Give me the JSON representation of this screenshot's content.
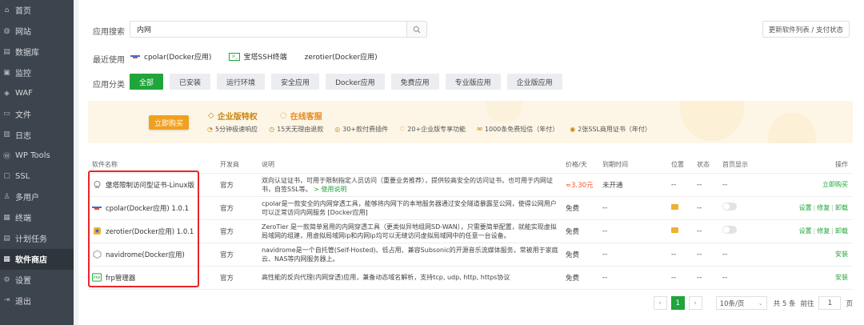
{
  "sidebar": {
    "items": [
      {
        "label": "首页",
        "icon": "home-icon",
        "glyph": "⌂"
      },
      {
        "label": "网站",
        "icon": "globe-icon",
        "glyph": "◍"
      },
      {
        "label": "数据库",
        "icon": "database-icon",
        "glyph": "▤"
      },
      {
        "label": "监控",
        "icon": "monitor-icon",
        "glyph": "▣"
      },
      {
        "label": "WAF",
        "icon": "shield-icon",
        "glyph": "◈"
      },
      {
        "label": "文件",
        "icon": "folder-icon",
        "glyph": "▭"
      },
      {
        "label": "日志",
        "icon": "log-icon",
        "glyph": "▥"
      },
      {
        "label": "WP Tools",
        "icon": "wordpress-icon",
        "glyph": "Ⓦ"
      },
      {
        "label": "SSL",
        "icon": "ssl-icon",
        "glyph": "▢"
      },
      {
        "label": "多用户",
        "icon": "users-icon",
        "glyph": "♙"
      },
      {
        "label": "终端",
        "icon": "terminal-icon",
        "glyph": "▦"
      },
      {
        "label": "计划任务",
        "icon": "cron-icon",
        "glyph": "▤"
      },
      {
        "label": "软件商店",
        "icon": "store-icon",
        "glyph": "▦",
        "active": true
      },
      {
        "label": "设置",
        "icon": "settings-icon",
        "glyph": "⚙"
      },
      {
        "label": "退出",
        "icon": "logout-icon",
        "glyph": "⇥"
      }
    ]
  },
  "search": {
    "label": "应用搜索",
    "value": "内网",
    "update_button": "更新软件列表 / 支付状态"
  },
  "recent": {
    "label": "最近使用",
    "items": [
      {
        "label": "cpolar(Docker应用)",
        "icon": "cpolar-icon"
      },
      {
        "label": "宝塔SSH终端",
        "icon": "ssh-terminal-icon"
      },
      {
        "label": "zerotier(Docker应用)",
        "icon": "zerotier-icon"
      }
    ]
  },
  "categories": {
    "label": "应用分类",
    "items": [
      "全部",
      "已安装",
      "运行环境",
      "安全应用",
      "Docker应用",
      "免费应用",
      "专业版应用",
      "企业版应用"
    ]
  },
  "banner": {
    "buy_button": "立即购买",
    "title_enterprise": "企业版特权",
    "title_service": "在线客服",
    "features": [
      "5分钟极速响应",
      "15天无理由退款",
      "30+款付费插件",
      "20+企业版专享功能",
      "1000条免费短信（年付）",
      "2张SSL商用证书（年付）"
    ]
  },
  "table": {
    "headers": {
      "name": "软件名称",
      "developer": "开发商",
      "desc": "说明",
      "price": "价格/天",
      "expire": "到期时间",
      "location": "位置",
      "status": "状态",
      "homepage": "首页显示",
      "ops": "操作"
    },
    "rows": [
      {
        "name": "堡塔限制访问型证书-Linux版",
        "icon": "cert-icon",
        "developer": "官方",
        "desc": "双向认证证书，可用于限制指定人员访问（重要业务推荐），提供较高安全的访问证书，也可用于内网证书，自签SSL等。",
        "desc_link": "> 使用说明",
        "price": "≈3.30元",
        "expire": "未开通",
        "location": "--",
        "status": "--",
        "homepage": "--",
        "ops": [
          "立即购买"
        ]
      },
      {
        "name": "cpolar(Docker应用) 1.0.1",
        "icon": "cpolar-icon",
        "developer": "官方",
        "desc": "cpolar是一款安全的内网穿透工具，能够将内网下的本地服务器通过安全隧道暴露至公网，使得公网用户可以正常访问内网服务 [Docker应用]",
        "price": "免费",
        "expire": "--",
        "location": "folder",
        "status": "--",
        "homepage": "toggle",
        "ops": [
          "设置",
          "修复",
          "卸载"
        ]
      },
      {
        "name": "zerotier(Docker应用) 1.0.1",
        "icon": "zerotier-icon",
        "developer": "官方",
        "desc": "ZeroTier 是一款简单易用的内网穿透工具（更类似异地组网SD-WAN），只需要简单配置，就能实现虚拟局域网的组建，用虚拟局域网ip和内网ip均可以无缝访问虚拟局域网中的任意一台设备。",
        "price": "免费",
        "expire": "--",
        "location": "folder",
        "status": "--",
        "homepage": "toggle",
        "ops": [
          "设置",
          "修复",
          "卸载"
        ]
      },
      {
        "name": "navidrome(Docker应用)",
        "icon": "navidrome-icon",
        "developer": "官方",
        "desc": "navidrome是一个自托管(Self-Hosted)、低占用、兼容Subsonic的开源音乐流媒体服务，常被用于家庭云、NAS等内网服务器上。",
        "price": "免费",
        "expire": "--",
        "location": "--",
        "status": "--",
        "homepage": "--",
        "ops": [
          "安装"
        ]
      },
      {
        "name": "frp管理器",
        "icon": "frp-icon",
        "developer": "官方",
        "desc": "高性能的反向代理(内网穿透)应用，兼备动态域名解析，支持tcp, udp, http, https协议",
        "price": "免费",
        "expire": "--",
        "location": "--",
        "status": "--",
        "homepage": "--",
        "ops": [
          "安装"
        ]
      }
    ]
  },
  "pager": {
    "prev": "‹",
    "current": "1",
    "next": "›",
    "per_page": "10条/页",
    "total": "共 5 条",
    "goto_label": "前往",
    "goto_value": "1",
    "goto_unit": "页"
  },
  "colors": {
    "accent": "#20a53a",
    "price_red": "#f0542f",
    "highlight_box": "#e8262b"
  }
}
